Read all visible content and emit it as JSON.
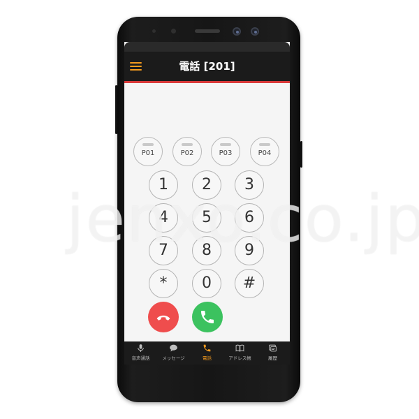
{
  "header": {
    "title": "電話 [201]"
  },
  "presets": [
    {
      "label": "P01"
    },
    {
      "label": "P02"
    },
    {
      "label": "P03"
    },
    {
      "label": "P04"
    }
  ],
  "keypad": {
    "keys": [
      "1",
      "2",
      "3",
      "4",
      "5",
      "6",
      "7",
      "8",
      "9",
      "*",
      "0",
      "#"
    ]
  },
  "call_buttons": {
    "hangup_icon": "phone-hangup-icon",
    "dial_icon": "phone-dial-icon"
  },
  "bottom_nav": {
    "items": [
      {
        "label": "音声通話",
        "icon": "microphone-icon"
      },
      {
        "label": "メッセージ",
        "icon": "chat-bubble-icon"
      },
      {
        "label": "電話",
        "icon": "phone-icon",
        "active": true
      },
      {
        "label": "アドレス帳",
        "icon": "book-icon"
      },
      {
        "label": "履歴",
        "icon": "history-icon"
      }
    ]
  },
  "colors": {
    "accent": "#f39a1e",
    "header_line": "#d93a3a",
    "hangup": "#ef4d4d",
    "dial": "#3cc25f"
  },
  "watermark": "jenxo.co.jp"
}
